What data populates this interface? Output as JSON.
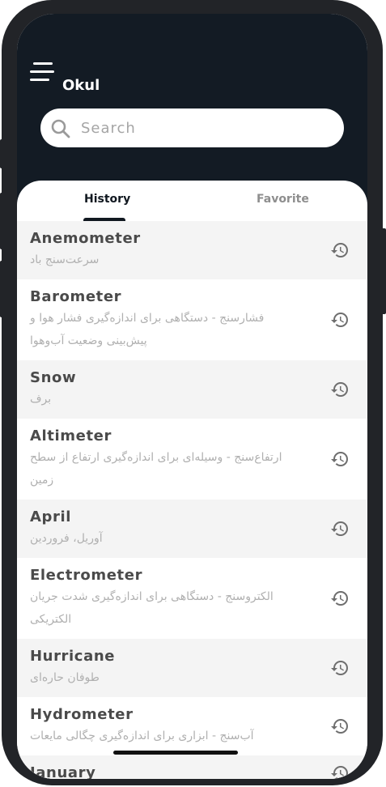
{
  "app": {
    "title": "Okul"
  },
  "search": {
    "placeholder": "Search",
    "value": ""
  },
  "tabs": [
    {
      "label": "History",
      "active": true
    },
    {
      "label": "Favorite",
      "active": false
    }
  ],
  "history": [
    {
      "word": "Anemometer",
      "meaning": "سرعت‌سنج باد",
      "icon": "history-icon"
    },
    {
      "word": "Barometer",
      "meaning": "فشارسنج - دستگاهی برای اندازه‌گیری فشار هوا و پیش‌بینی وضعیت آب‌وهوا",
      "icon": "history-icon"
    },
    {
      "word": "Snow",
      "meaning": "برف",
      "icon": "history-icon"
    },
    {
      "word": "Altimeter",
      "meaning": "ارتفاع‌سنج - وسیله‌ای برای اندازه‌گیری ارتفاع از سطح زمین",
      "icon": "history-icon"
    },
    {
      "word": "April",
      "meaning": "آوریل، فروردین",
      "icon": "history-icon"
    },
    {
      "word": "Electrometer",
      "meaning": "الکتروسنج - دستگاهی برای اندازه‌گیری شدت جریان الکتریکی",
      "icon": "history-icon"
    },
    {
      "word": "Hurricane",
      "meaning": "طوفان حاره‌ای",
      "icon": "history-icon"
    },
    {
      "word": "Hydrometer",
      "meaning": "آب‌سنج - ابزاری برای اندازه‌گیری چگالی مایعات",
      "icon": "history-icon"
    },
    {
      "word": "January",
      "meaning": "",
      "icon": "history-icon"
    }
  ],
  "colors": {
    "header_bg": "#131b24",
    "row_shade": "#f4f4f4",
    "word_text": "#4a4a4a",
    "meaning_text": "#b0b0b0",
    "tab_active": "#111820",
    "tab_inactive": "#8e8e8e"
  }
}
